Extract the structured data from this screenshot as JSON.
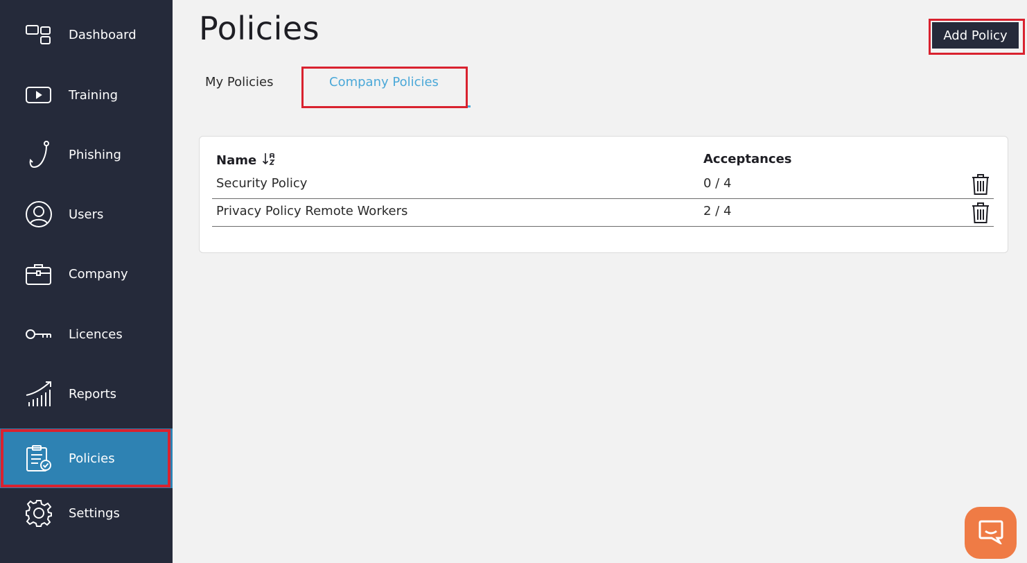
{
  "sidebar": {
    "items": [
      {
        "label": "Dashboard",
        "icon": "dashboard-icon"
      },
      {
        "label": "Training",
        "icon": "video-play-icon"
      },
      {
        "label": "Phishing",
        "icon": "fish-hook-icon"
      },
      {
        "label": "Users",
        "icon": "user-circle-icon"
      },
      {
        "label": "Company",
        "icon": "briefcase-icon"
      },
      {
        "label": "Licences",
        "icon": "key-icon"
      },
      {
        "label": "Reports",
        "icon": "chart-trend-icon"
      },
      {
        "label": "Policies",
        "icon": "clipboard-check-icon",
        "active": true
      },
      {
        "label": "Settings",
        "icon": "gear-icon"
      }
    ]
  },
  "page": {
    "title": "Policies"
  },
  "actions": {
    "add_policy_label": "Add Policy"
  },
  "tabs": [
    {
      "label": "My Policies",
      "active": false
    },
    {
      "label": "Company Policies",
      "active": true
    }
  ],
  "table": {
    "columns": [
      "Name",
      "Acceptances"
    ],
    "sort_icon": "sort-alpha-down-icon",
    "rows": [
      {
        "name": "Security Policy",
        "acceptances": "0 / 4"
      },
      {
        "name": "Privacy Policy Remote Workers",
        "acceptances": "2 / 4"
      }
    ]
  },
  "colors": {
    "sidebar_bg": "#252a3a",
    "active_nav": "#2e82b3",
    "highlight": "#d9222f",
    "tab_active": "#4aa8d8",
    "chat_button": "#ef7b45"
  },
  "chat": {
    "icon": "chat-bubble-icon"
  }
}
